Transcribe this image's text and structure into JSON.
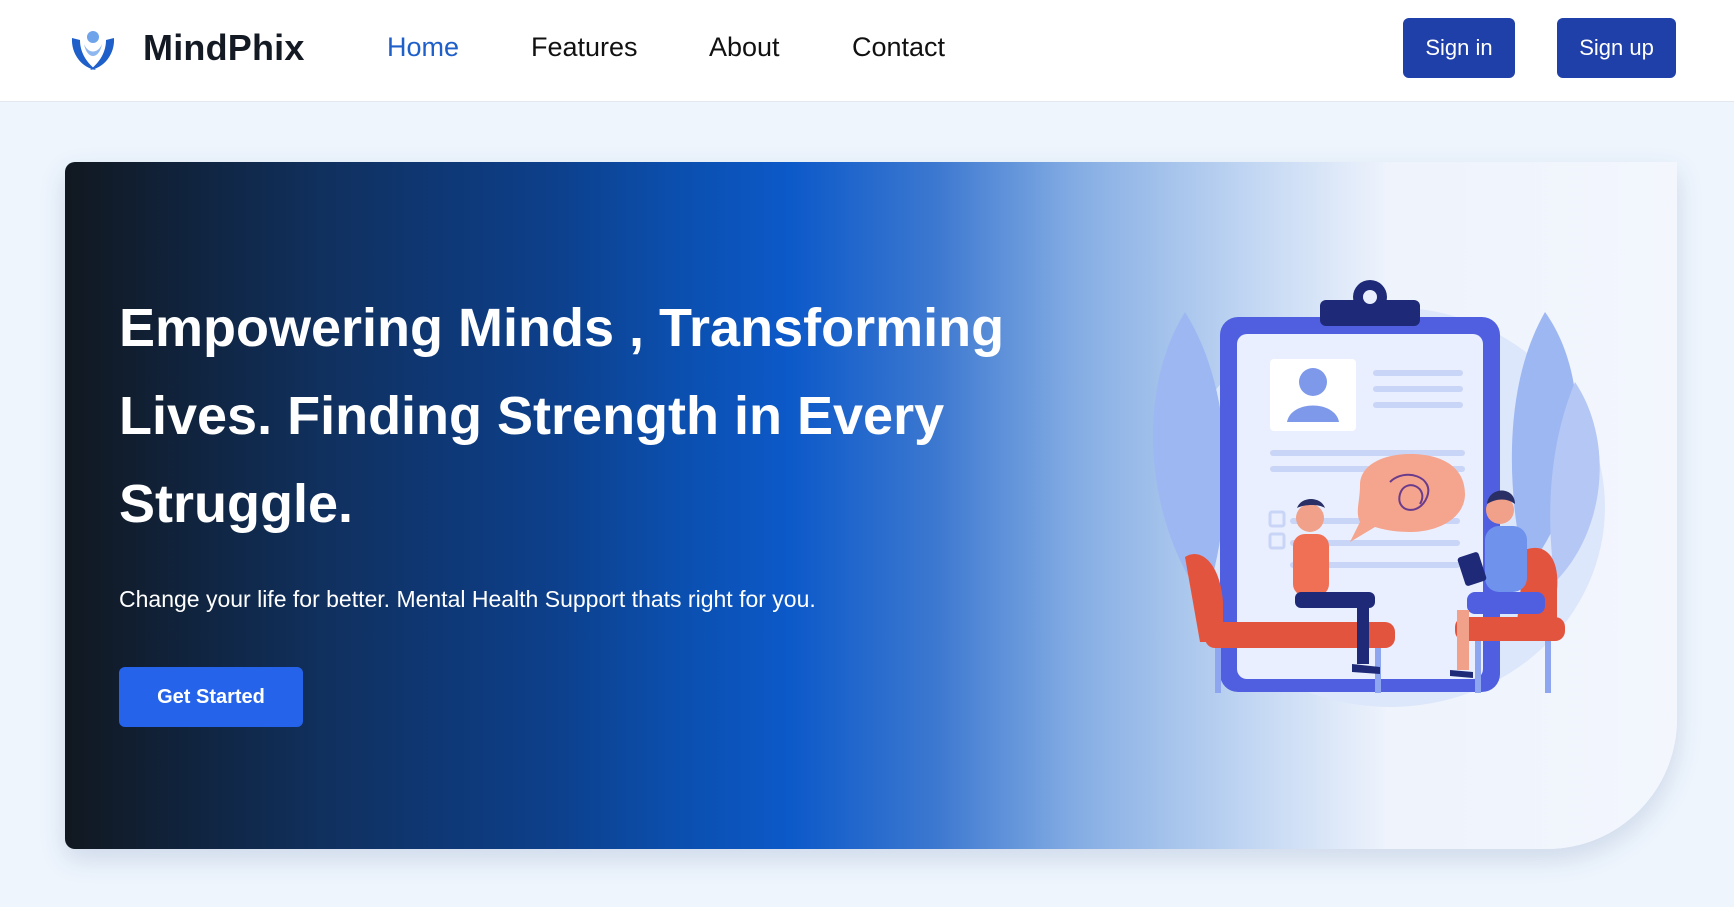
{
  "brand": {
    "name": "MindPhix",
    "logo_icon": "heart-hands-icon"
  },
  "nav": {
    "links": [
      {
        "label": "Home",
        "active": true
      },
      {
        "label": "Features",
        "active": false
      },
      {
        "label": "About",
        "active": false
      },
      {
        "label": "Contact",
        "active": false
      }
    ],
    "sign_in_label": "Sign in",
    "sign_up_label": "Sign up"
  },
  "hero": {
    "title": "Empowering Minds , Transforming Lives. Finding Strength in Every Struggle.",
    "subtitle": "Change your life for better. Mental Health Support thats right for you.",
    "cta_label": "Get Started",
    "illustration": "therapy-session-illustration"
  },
  "colors": {
    "accent": "#1e5fc9",
    "auth_button": "#1f3fa9",
    "cta_button": "#2563eb",
    "page_background": "#eef5fd"
  }
}
